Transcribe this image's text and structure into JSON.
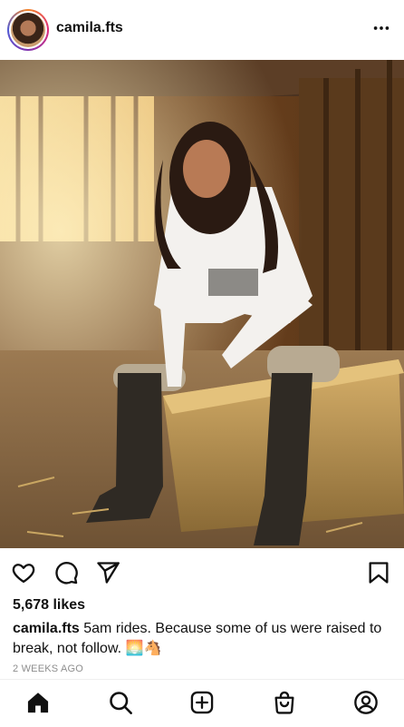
{
  "post": {
    "username": "camila.fts",
    "likes": "5,678 likes",
    "caption_user": "camila.fts",
    "caption_text": " 5am rides. Because some of us were raised to break, not follow. 🌅🐴",
    "timestamp": "2 WEEKS AGO"
  },
  "icons": {
    "more": "more-options-icon",
    "like": "heart-icon",
    "comment": "comment-icon",
    "share": "share-icon",
    "save": "bookmark-icon"
  },
  "nav": [
    "home-icon",
    "search-icon",
    "create-icon",
    "shop-icon",
    "profile-icon"
  ],
  "photo": {
    "description_tags": [
      "barn",
      "hay-bale",
      "riding-boots",
      "white-shirt"
    ]
  },
  "colors": {
    "text": "#111111",
    "muted": "#8e8e8e",
    "story_ring": "#dd2a7b"
  }
}
